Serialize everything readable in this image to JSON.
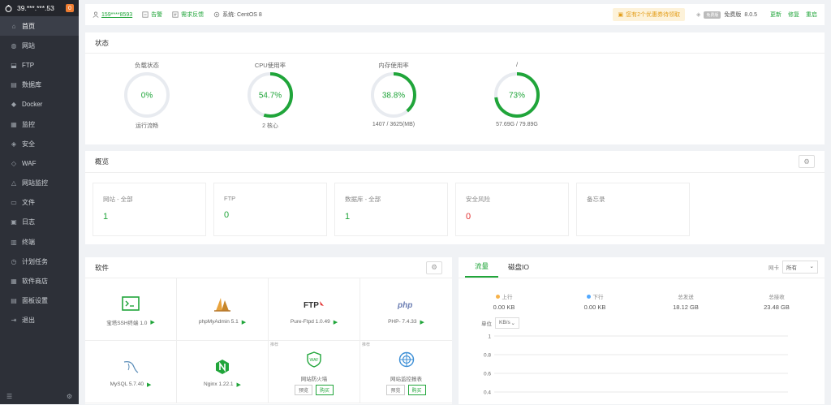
{
  "sidebar": {
    "server_ip": "39.***.***.53",
    "badge": "0",
    "items": [
      {
        "label": "首页",
        "icon": "home-icon"
      },
      {
        "label": "网站",
        "icon": "globe-icon"
      },
      {
        "label": "FTP",
        "icon": "ftp-icon"
      },
      {
        "label": "数据库",
        "icon": "database-icon"
      },
      {
        "label": "Docker",
        "icon": "docker-icon"
      },
      {
        "label": "监控",
        "icon": "monitor-icon"
      },
      {
        "label": "安全",
        "icon": "shield-icon"
      },
      {
        "label": "WAF",
        "icon": "waf-icon"
      },
      {
        "label": "网站监控",
        "icon": "chart-icon"
      },
      {
        "label": "文件",
        "icon": "folder-icon"
      },
      {
        "label": "日志",
        "icon": "log-icon"
      },
      {
        "label": "终端",
        "icon": "terminal-icon"
      },
      {
        "label": "计划任务",
        "icon": "clock-icon"
      },
      {
        "label": "软件商店",
        "icon": "store-icon"
      },
      {
        "label": "面板设置",
        "icon": "settings-icon"
      },
      {
        "label": "退出",
        "icon": "logout-icon"
      }
    ]
  },
  "topbar": {
    "user": "159****8593",
    "alarm": "告警",
    "feedback": "需求反馈",
    "system": "系统: CentOS 8",
    "notice": "您有2个优惠券待领取",
    "free_tag": "免费版",
    "version_label": "免费版",
    "version": "8.0.5",
    "update": "更新",
    "repair": "修复",
    "restart": "重启"
  },
  "status": {
    "title": "状态",
    "gauges": [
      {
        "title": "负载状态",
        "value": "0%",
        "percent": 0,
        "foot": "运行流畅"
      },
      {
        "title": "CPU使用率",
        "value": "54.7%",
        "percent": 54.7,
        "foot": "2 核心"
      },
      {
        "title": "内存使用率",
        "value": "38.8%",
        "percent": 38.8,
        "foot": "1407 / 3625(MB)"
      },
      {
        "title": "/",
        "value": "73%",
        "percent": 73,
        "foot": "57.69G / 79.89G"
      }
    ],
    "colors": {
      "ok": "#20a53a",
      "track": "#e8ebf0"
    }
  },
  "overview": {
    "title": "概览",
    "cards": [
      {
        "label": "网站 - 全部",
        "value": "1",
        "red": false
      },
      {
        "label": "FTP",
        "value": "0",
        "red": false
      },
      {
        "label": "数据库 - 全部",
        "value": "1",
        "red": false
      },
      {
        "label": "安全风险",
        "value": "0",
        "red": true
      },
      {
        "label": "备忘录",
        "value": "",
        "red": false
      }
    ]
  },
  "software": {
    "title": "软件",
    "items": [
      {
        "name": "宝塔SSH终端 1.0",
        "icon": "ssh-terminal-icon"
      },
      {
        "name": "phpMyAdmin 5.1",
        "icon": "phpmyadmin-icon"
      },
      {
        "name": "Pure-Ftpd 1.0.49",
        "icon": "pureftpd-icon"
      },
      {
        "name": "PHP- 7.4.33",
        "icon": "php-icon"
      },
      {
        "name": "MySQL 5.7.40",
        "icon": "mysql-icon"
      },
      {
        "name": "Nginx 1.22.1",
        "icon": "nginx-icon"
      },
      {
        "name": "网站防火墙",
        "icon": "waf-shield-icon",
        "recommend": "推荐",
        "trial": "预览",
        "buy": "购买"
      },
      {
        "name": "网站监控报表",
        "icon": "site-report-icon",
        "recommend": "推荐",
        "trial": "预览",
        "buy": "购买"
      }
    ]
  },
  "traffic": {
    "tabs": [
      "流量",
      "磁盘IO"
    ],
    "nic_label": "网卡",
    "nic_value": "所有",
    "stats": [
      {
        "label": "上行",
        "value": "0.00 KB",
        "dot": "#f7b24a"
      },
      {
        "label": "下行",
        "value": "0.00 KB",
        "dot": "#52a9ff"
      },
      {
        "label": "总发送",
        "value": "18.12 GB",
        "dot": ""
      },
      {
        "label": "总接收",
        "value": "23.48 GB",
        "dot": ""
      }
    ],
    "unit_label": "单位",
    "unit_value": "KB/s",
    "chart_data": {
      "type": "line",
      "series": [],
      "ylim": [
        0.4,
        1
      ],
      "yticks": [
        "1",
        "0.8",
        "0.6",
        "0.4"
      ]
    }
  }
}
